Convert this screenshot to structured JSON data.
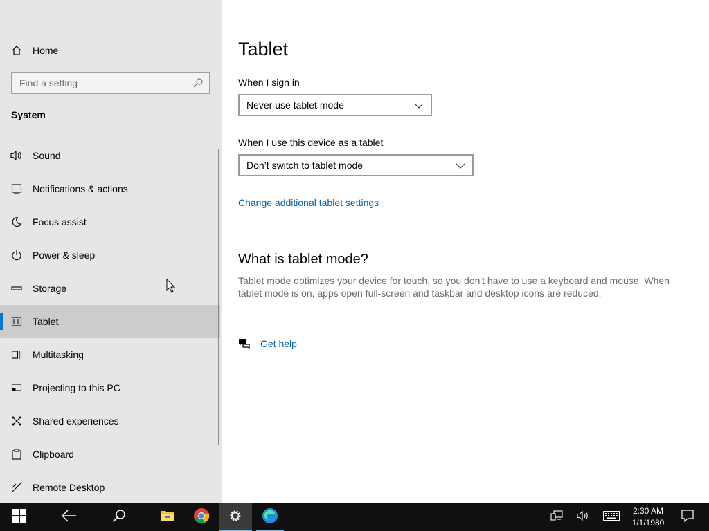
{
  "sidebar": {
    "home_label": "Home",
    "search_placeholder": "Find a setting",
    "section_title": "System",
    "items": [
      {
        "label": "Sound",
        "icon": "speaker-icon"
      },
      {
        "label": "Notifications & actions",
        "icon": "notification-icon"
      },
      {
        "label": "Focus assist",
        "icon": "moon-icon"
      },
      {
        "label": "Power & sleep",
        "icon": "power-icon"
      },
      {
        "label": "Storage",
        "icon": "storage-icon"
      },
      {
        "label": "Tablet",
        "icon": "tablet-icon",
        "selected": true
      },
      {
        "label": "Multitasking",
        "icon": "multitasking-icon"
      },
      {
        "label": "Projecting to this PC",
        "icon": "projecting-icon"
      },
      {
        "label": "Shared experiences",
        "icon": "shared-experiences-icon"
      },
      {
        "label": "Clipboard",
        "icon": "clipboard-icon"
      },
      {
        "label": "Remote Desktop",
        "icon": "remote-desktop-icon"
      }
    ]
  },
  "main": {
    "title": "Tablet",
    "sign_in_label": "When I sign in",
    "sign_in_value": "Never use tablet mode",
    "device_label": "When I use this device as a tablet",
    "device_value": "Don’t switch to tablet mode",
    "additional_link": "Change additional tablet settings",
    "what_heading": "What is tablet mode?",
    "what_desc": "Tablet mode optimizes your device for touch, so you don't have to use a keyboard and mouse. When tablet mode is on, apps open full-screen and taskbar and desktop icons are reduced.",
    "help_link": "Get help"
  },
  "taskbar": {
    "time": "2:30 AM",
    "date": "1/1/1980",
    "apps": [
      "start-icon",
      "back-icon",
      "search-icon",
      "file-explorer-icon",
      "chrome-icon",
      "settings-icon",
      "edge-icon"
    ]
  },
  "colors": {
    "accent": "#0078d7",
    "link": "#0063b1",
    "sidebar_bg": "#e6e6e6",
    "taskbar_bg": "#101010"
  }
}
